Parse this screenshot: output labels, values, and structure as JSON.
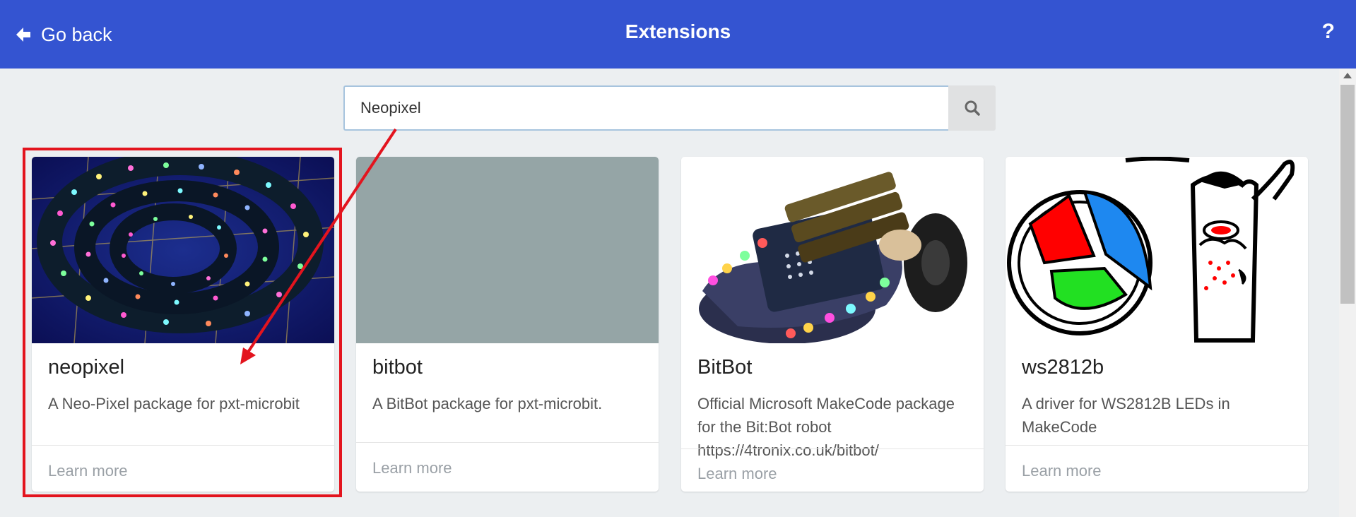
{
  "header": {
    "back_label": "Go back",
    "title": "Extensions",
    "help_label": "?",
    "background_color": "#3454d1"
  },
  "search": {
    "value": "Neopixel",
    "icon": "search-icon"
  },
  "cards": [
    {
      "name": "neopixel",
      "description": "A Neo-Pixel package for pxt-microbit",
      "learn_more": "Learn more",
      "image": "neopixel-led-strip-image"
    },
    {
      "name": "bitbot",
      "description": "A BitBot package for pxt-microbit.",
      "learn_more": "Learn more",
      "image": "gray-placeholder",
      "placeholder_color": "#95a5a6"
    },
    {
      "name": "BitBot",
      "description": "Official Microsoft MakeCode package for the Bit:Bot robot https://4tronix.co.uk/bitbot/",
      "learn_more": "Learn more",
      "image": "bitbot-robot-image"
    },
    {
      "name": "ws2812b",
      "description": "A driver for WS2812B LEDs in MakeCode",
      "learn_more": "Learn more",
      "image": "ws2812b-drawing-image"
    }
  ],
  "annotation": {
    "color": "#e3141e"
  }
}
